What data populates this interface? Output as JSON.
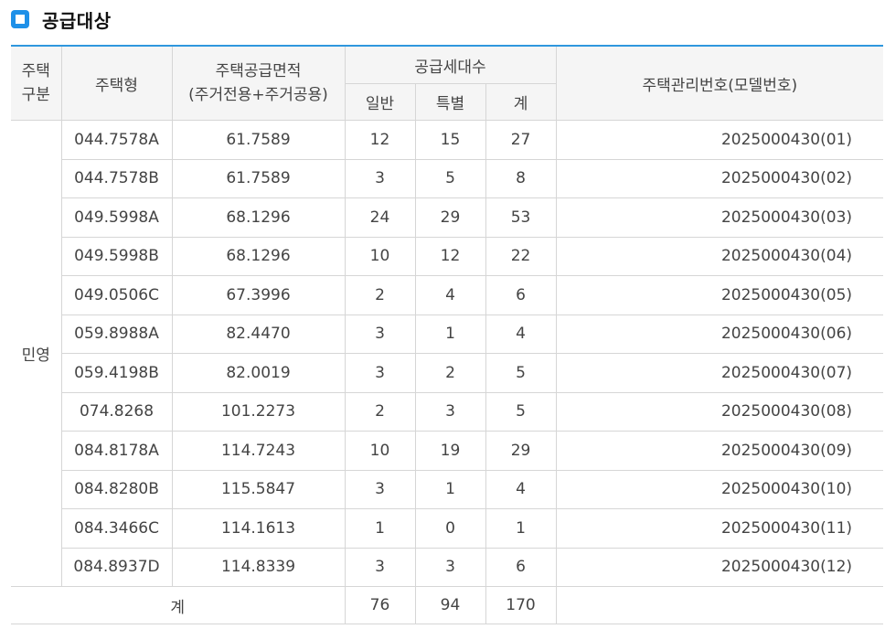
{
  "section_title": "공급대상",
  "colors": {
    "accent": "#2f97de",
    "icon": "#1e90e8",
    "header_bg": "#f5f5f5"
  },
  "header": {
    "category_line1": "주택",
    "category_line2": "구분",
    "type": "주택형",
    "area_line1": "주택공급면적",
    "area_line2": "(주거전용+주거공용)",
    "units_group": "공급세대수",
    "general": "일반",
    "special": "특별",
    "total": "계",
    "model_no": "주택관리번호(모델번호)"
  },
  "category": "민영",
  "rows": [
    {
      "type": "044.7578A",
      "area": "61.7589",
      "general": "12",
      "special": "15",
      "total": "27",
      "model_no": "2025000430(01)"
    },
    {
      "type": "044.7578B",
      "area": "61.7589",
      "general": "3",
      "special": "5",
      "total": "8",
      "model_no": "2025000430(02)"
    },
    {
      "type": "049.5998A",
      "area": "68.1296",
      "general": "24",
      "special": "29",
      "total": "53",
      "model_no": "2025000430(03)"
    },
    {
      "type": "049.5998B",
      "area": "68.1296",
      "general": "10",
      "special": "12",
      "total": "22",
      "model_no": "2025000430(04)"
    },
    {
      "type": "049.0506C",
      "area": "67.3996",
      "general": "2",
      "special": "4",
      "total": "6",
      "model_no": "2025000430(05)"
    },
    {
      "type": "059.8988A",
      "area": "82.4470",
      "general": "3",
      "special": "1",
      "total": "4",
      "model_no": "2025000430(06)"
    },
    {
      "type": "059.4198B",
      "area": "82.0019",
      "general": "3",
      "special": "2",
      "total": "5",
      "model_no": "2025000430(07)"
    },
    {
      "type": "074.8268",
      "area": "101.2273",
      "general": "2",
      "special": "3",
      "total": "5",
      "model_no": "2025000430(08)"
    },
    {
      "type": "084.8178A",
      "area": "114.7243",
      "general": "10",
      "special": "19",
      "total": "29",
      "model_no": "2025000430(09)"
    },
    {
      "type": "084.8280B",
      "area": "115.5847",
      "general": "3",
      "special": "1",
      "total": "4",
      "model_no": "2025000430(10)"
    },
    {
      "type": "084.3466C",
      "area": "114.1613",
      "general": "1",
      "special": "0",
      "total": "1",
      "model_no": "2025000430(11)"
    },
    {
      "type": "084.8937D",
      "area": "114.8339",
      "general": "3",
      "special": "3",
      "total": "6",
      "model_no": "2025000430(12)"
    }
  ],
  "footer": {
    "label": "계",
    "general": "76",
    "special": "94",
    "total": "170"
  }
}
